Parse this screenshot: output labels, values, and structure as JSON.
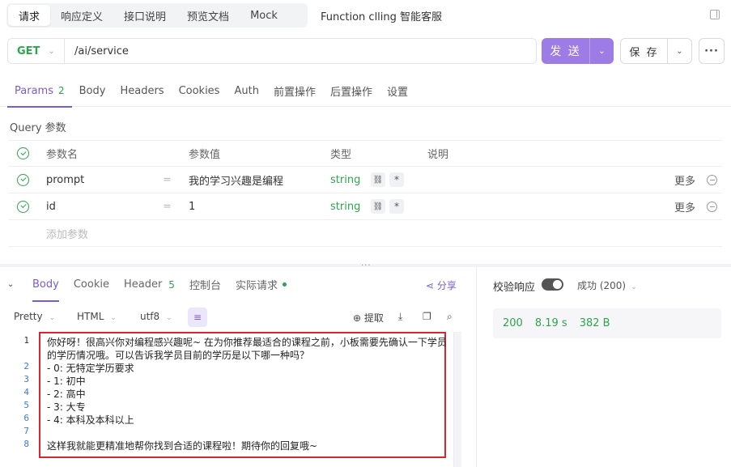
{
  "top_tabs": [
    "请求",
    "响应定义",
    "接口说明",
    "预览文档",
    "Mock"
  ],
  "doc_title": "Function clling 智能客服",
  "request": {
    "method": "GET",
    "url": "/ai/service",
    "send_label": "发 送",
    "save_label": "保 存"
  },
  "req_tabs": {
    "params": "Params",
    "params_count": "2",
    "body": "Body",
    "headers": "Headers",
    "cookies": "Cookies",
    "auth": "Auth",
    "pre_ops": "前置操作",
    "post_ops": "后置操作",
    "settings": "设置"
  },
  "query_label": "Query 参数",
  "params_header": {
    "name": "参数名",
    "value": "参数值",
    "type": "类型",
    "desc": "说明"
  },
  "params": [
    {
      "name": "prompt",
      "eq": "=",
      "value": "我的学习兴趣是编程",
      "type": "string",
      "req": "*",
      "more": "更多"
    },
    {
      "name": "id",
      "eq": "=",
      "value": "1",
      "type": "string",
      "req": "*",
      "more": "更多"
    }
  ],
  "add_param": "添加参数",
  "resp_tabs": {
    "body": "Body",
    "cookie": "Cookie",
    "header": "Header",
    "header_count": "5",
    "console": "控制台",
    "actual": "实际请求",
    "share": "分享"
  },
  "format_bar": {
    "pretty": "Pretty",
    "lang": "HTML",
    "encoding": "utf8",
    "extract": "提取"
  },
  "code": {
    "line_numbers": [
      "1",
      "",
      "2",
      "3",
      "4",
      "5",
      "6",
      "7",
      "8"
    ],
    "lines": [
      "你好呀！很高兴你对编程感兴趣呢~ 在为你推荐最适合的课程之前，小板需要先确认一下学员",
      "的学历情况哦。可以告诉我学员目前的学历是以下哪一种吗？",
      "- 0: 无特定学历要求",
      "- 1: 初中",
      "- 2: 高中",
      "- 3: 大专",
      "- 4: 本科及本科以上",
      "",
      "这样我就能更精准地帮你找到合适的课程啦！期待你的回复哦~"
    ]
  },
  "verify": {
    "label": "校验响应",
    "status_label": "成功 (200)"
  },
  "stats": {
    "code": "200",
    "time": "8.19 s",
    "size": "382 B"
  }
}
